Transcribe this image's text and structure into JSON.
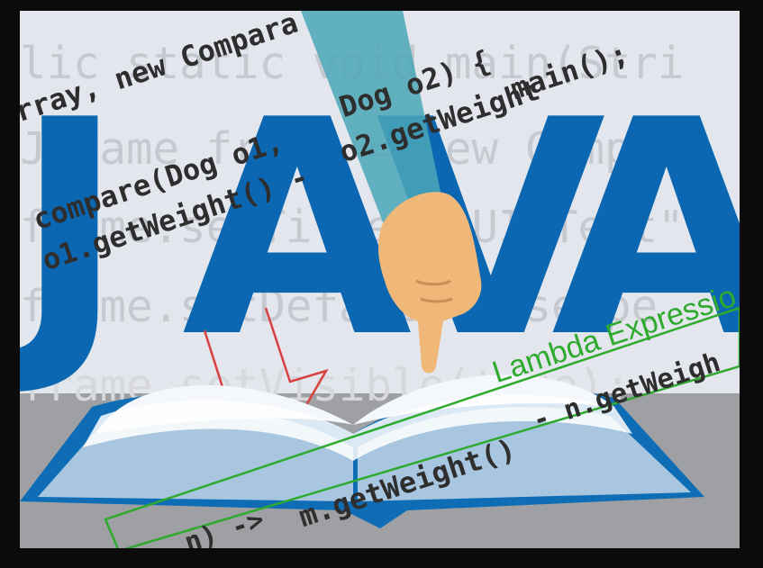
{
  "background_code": [
    "lic static void main(Stri",
    "JFrame frame = new Compara",
    "frame.setTitle(\"GUI Test\"",
    "frame.setDefaultCloseOpe",
    "frame.setVisible(true);"
  ],
  "title_letters": [
    "J",
    "A",
    "V",
    "A"
  ],
  "tilted_code": {
    "line1": "rray, new Compara",
    "line2": "Dog o2) {",
    "line3": "main();",
    "line4": "compare(Dog o1,",
    "line5": "o2.getWeight",
    "line6": "o1.getWeight() -",
    "line7": "- n.getWeigh",
    "line8": "m.getWeight()",
    "line9": "(m, n) -> "
  },
  "annotation": {
    "label": "Lambda Expressio"
  },
  "colors": {
    "java_blue": "#0b67b1",
    "lambda_green": "#2faa2f",
    "arrow_red": "#d94040",
    "sleeve": "#4aa6b8",
    "skin": "#f0b878",
    "book_cover": "#0f6db5"
  },
  "icons": [
    "open-book-icon",
    "pointing-hand-icon",
    "down-arrow-icon"
  ]
}
